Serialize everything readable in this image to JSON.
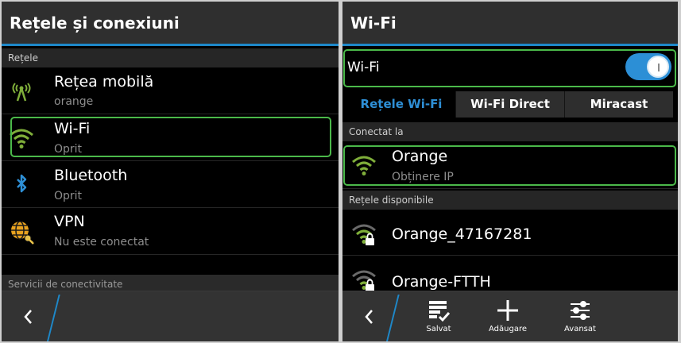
{
  "left": {
    "title": "Rețele și conexiuni",
    "section_networks": "Rețele",
    "items": [
      {
        "label": "Rețea mobilă",
        "sub": "orange"
      },
      {
        "label": "Wi-Fi",
        "sub": "Oprit"
      },
      {
        "label": "Bluetooth",
        "sub": "Oprit"
      },
      {
        "label": "VPN",
        "sub": "Nu este conectat"
      }
    ],
    "section_services": "Servicii de conectivitate"
  },
  "right": {
    "title": "Wi-Fi",
    "wifi_toggle_label": "Wi-Fi",
    "wifi_on": true,
    "tabs": [
      "Rețele Wi-Fi",
      "Wi-Fi Direct",
      "Miracast"
    ],
    "active_tab": 0,
    "section_connected": "Conectat la",
    "connected": {
      "label": "Orange",
      "sub": "Obținere IP"
    },
    "section_available": "Rețele disponibile",
    "available": [
      {
        "label": "Orange_47167281"
      },
      {
        "label": "Orange-FTTH"
      }
    ],
    "actions": [
      "Salvat",
      "Adăugare",
      "Avansat"
    ]
  },
  "colors": {
    "accent": "#1e88c9",
    "highlight": "#4bb94a",
    "wifi_green": "#7fae3a"
  }
}
